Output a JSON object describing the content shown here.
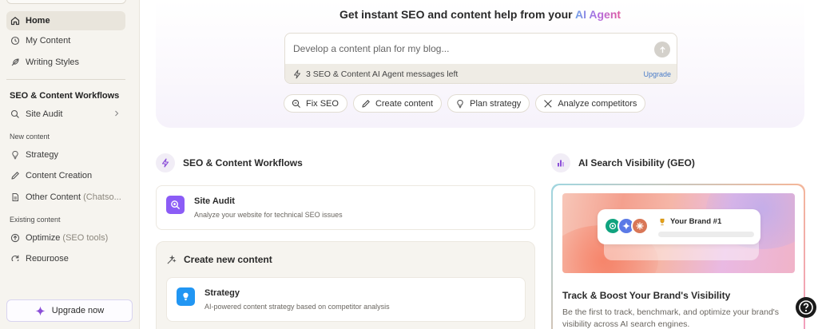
{
  "sidebar": {
    "items": [
      {
        "label": "Home",
        "active": true,
        "icon": "home-icon"
      },
      {
        "label": "My Content",
        "icon": "history-icon"
      },
      {
        "label": "Writing Styles",
        "icon": "feather-icon"
      }
    ],
    "workflows_heading": "SEO & Content Workflows",
    "site_audit_label": "Site Audit",
    "new_content_heading": "New content",
    "new_content_items": [
      {
        "label": "Strategy",
        "icon": "lightbulb-icon"
      },
      {
        "label": "Content Creation",
        "icon": "pencil-icon"
      },
      {
        "label": "Other Content",
        "muted": "(Chatso...",
        "icon": "document-icon"
      }
    ],
    "existing_content_heading": "Existing content",
    "existing_content_items": [
      {
        "label": "Optimize",
        "muted": "(SEO tools)",
        "icon": "arrow-up-circle-icon"
      },
      {
        "label": "Repurpose",
        "icon": "refresh-icon"
      }
    ],
    "upgrade_label": "Upgrade now"
  },
  "hero": {
    "title_prefix": "Get instant SEO and content help from your",
    "title_highlight": "AI Agent",
    "prompt_placeholder": "Develop a content plan for my blog...",
    "messages_left": "3 SEO & Content AI Agent messages left",
    "upgrade_link": "Upgrade",
    "chips": [
      {
        "label": "Fix SEO",
        "icon": "search-zoom-icon"
      },
      {
        "label": "Create content",
        "icon": "pencil-icon"
      },
      {
        "label": "Plan strategy",
        "icon": "lightbulb-icon"
      },
      {
        "label": "Analyze competitors",
        "icon": "swords-icon"
      }
    ]
  },
  "workflows": {
    "heading": "SEO & Content Workflows",
    "site_audit": {
      "title": "Site Audit",
      "description": "Analyze your website for technical SEO issues"
    },
    "create_group": {
      "heading": "Create new content",
      "strategy": {
        "title": "Strategy",
        "description": "AI-powered content strategy based on competitor analysis"
      }
    }
  },
  "geo": {
    "heading": "AI Search Visibility (GEO)",
    "brand_label": "Your Brand #1",
    "title": "Track & Boost Your Brand's Visibility",
    "description": "Be the first to track, benchmark, and optimize your brand's visibility across AI search engines."
  },
  "colors": {
    "accent_purple": "#8b4fd8",
    "link_blue": "#4a7cc9",
    "strategy_blue": "#2196f3"
  }
}
